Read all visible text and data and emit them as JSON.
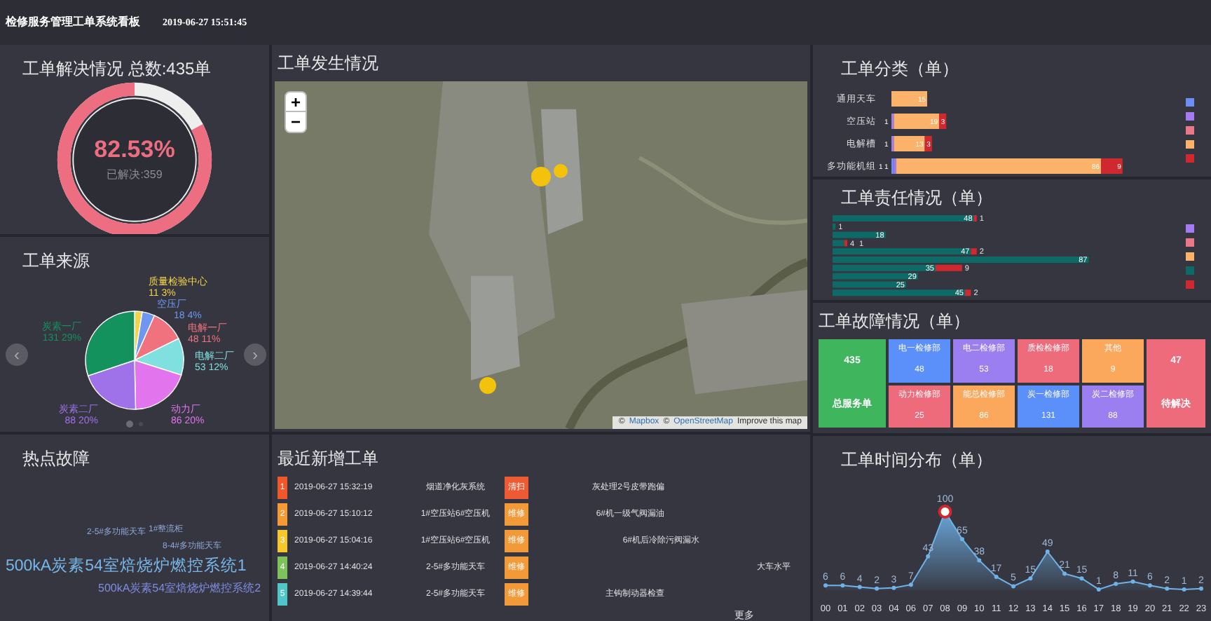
{
  "header": {
    "title": "检修服务管理工单系统看板",
    "datetime": "2019-06-27 15:51:45"
  },
  "resolution": {
    "title": "工单解决情况 总数:435单",
    "percent": "82.53%",
    "caption": "已解决:359",
    "level": 0.8253
  },
  "source": {
    "title": "工单来源",
    "prev": "‹",
    "next": "›",
    "dots": [
      {
        "selected": true
      },
      {
        "selected": false
      }
    ],
    "chart_data": {
      "type": "pie",
      "categories": [
        "质量检验中心",
        "空压厂",
        "电解一厂",
        "电解二厂",
        "动力厂",
        "炭素二厂",
        "炭素一厂"
      ],
      "values": [
        11,
        18,
        48,
        53,
        86,
        88,
        131
      ],
      "colors": [
        "#f2d34a",
        "#6f97f2",
        "#f0727e",
        "#7fe0df",
        "#e274ee",
        "#9f72ea",
        "#14925e"
      ],
      "value_labels": [
        "11  3%",
        "18  4%",
        "48  11%",
        "53  12%",
        "86  20%",
        "88  20%",
        "131  29%"
      ]
    }
  },
  "hot": {
    "title": "热点故障",
    "words": [
      {
        "text": "2-5#多功能天车"
      },
      {
        "text": "1#整流柜"
      },
      {
        "text": "8-4#多功能天车"
      },
      {
        "text": "500kA炭素54室焙烧炉燃控系统1"
      },
      {
        "text": "500kA炭素54室焙烧炉燃控系统2"
      }
    ]
  },
  "map": {
    "title": "工单发生情况",
    "zoom_in": "+",
    "zoom_out": "−",
    "attribution": [
      {
        "text": "©",
        "link": false
      },
      {
        "text": "Mapbox",
        "link": true
      },
      {
        "text": "©",
        "link": false
      },
      {
        "text": "OpenStreetMap",
        "link": true
      },
      {
        "text": "Improve this map",
        "link": false
      }
    ]
  },
  "orders": {
    "title": "最近新增工单",
    "more": "更多",
    "rows": [
      {
        "index": "1",
        "color": "#f0582c",
        "time": "2019-06-27 15:32:19",
        "device": "烟道净化灰系统",
        "badge": "清扫",
        "kind": "clean",
        "desc": "灰处理2号皮带跑偏"
      },
      {
        "index": "2",
        "color": "#f59a34",
        "time": "2019-06-27 15:10:12",
        "device": "1#空压站6#空压机",
        "badge": "维修",
        "kind": "repair",
        "desc": "6#机一级气阀漏油"
      },
      {
        "index": "3",
        "color": "#f6c82e",
        "time": "2019-06-27 15:04:16",
        "device": "1#空压站6#空压机",
        "badge": "维修",
        "kind": "repair",
        "desc": "6#机后冷除污阀漏水"
      },
      {
        "index": "4",
        "color": "#7dc25b",
        "time": "2019-06-27 14:40:24",
        "device": "2-5#多功能天车",
        "badge": "维修",
        "kind": "repair",
        "desc": "大车水平"
      },
      {
        "index": "5",
        "color": "#4fc6c9",
        "time": "2019-06-27 14:39:44",
        "device": "2-5#多功能天车",
        "badge": "维修",
        "kind": "repair",
        "desc": "主钩制动器检查"
      }
    ]
  },
  "category": {
    "title": "工单分类（单）",
    "chart_data": {
      "type": "bar",
      "orientation": "horizontal",
      "stacked": true,
      "data_labels": true,
      "categories": [
        "通用天车",
        "空压站",
        "电解槽",
        "多功能机组"
      ],
      "series": [
        {
          "color": "#6e8ef5",
          "values": [
            null,
            null,
            null,
            1
          ]
        },
        {
          "color": "#a47cf0",
          "values": [
            null,
            1,
            1,
            1
          ]
        },
        {
          "color": "#fbb36b",
          "values": [
            15,
            19,
            13,
            86
          ]
        },
        {
          "color": "#d0282f",
          "values": [
            null,
            3,
            3,
            9
          ]
        }
      ]
    },
    "legend": [
      {
        "color": "#6e8ef5"
      },
      {
        "color": "#a47cf0"
      },
      {
        "color": "#e8798a"
      },
      {
        "color": "#fbb36b"
      },
      {
        "color": "#d0282f"
      }
    ]
  },
  "duty": {
    "title": "工单责任情况（单）",
    "chart_data": {
      "type": "bar",
      "orientation": "horizontal",
      "stacked": true,
      "data_labels": true,
      "series": [
        {
          "color": "#0e6a66",
          "values": [
            48,
            1,
            18,
            4,
            47,
            87,
            35,
            29,
            25,
            45
          ]
        },
        {
          "color": "#d0282f",
          "values": [
            1,
            null,
            null,
            1,
            2,
            null,
            9,
            null,
            null,
            2
          ]
        }
      ]
    },
    "legend": [
      {
        "color": "#a47cf0"
      },
      {
        "color": "#e8798a"
      },
      {
        "color": "#fbb36b"
      },
      {
        "color": "#0e6a66"
      },
      {
        "color": "#d0282f"
      }
    ]
  },
  "faults": {
    "title": "工单故障情况（单）",
    "total": {
      "value": "435",
      "label": "总服务单",
      "color": "#3fb65e"
    },
    "pending": {
      "value": "47",
      "label": "待解决",
      "color": "#ee6b7c"
    },
    "groups": [
      [
        {
          "name": "电一检修部",
          "value": "48",
          "color": "#5b8ff9"
        },
        {
          "name": "电二检修部",
          "value": "53",
          "color": "#9b7ef0"
        },
        {
          "name": "动力检修部",
          "value": "25",
          "color": "#ee6b7c"
        },
        {
          "name": "能总检修部",
          "value": "86",
          "color": "#fba85d"
        }
      ],
      [
        {
          "name": "质检检修部",
          "value": "18",
          "color": "#ee6b7c"
        },
        {
          "name": "其他",
          "value": "9",
          "color": "#fba85d"
        },
        {
          "name": "炭一检修部",
          "value": "131",
          "color": "#5b8ff9"
        },
        {
          "name": "炭二检修部",
          "value": "88",
          "color": "#9b7ef0"
        }
      ]
    ]
  },
  "timeline": {
    "title": "工单时间分布（单）",
    "chart_data": {
      "type": "area",
      "data_labels": true,
      "x": [
        "00",
        "01",
        "02",
        "03",
        "04",
        "06",
        "07",
        "08",
        "09",
        "10",
        "11",
        "12",
        "13",
        "14",
        "15",
        "16",
        "17",
        "18",
        "19",
        "20",
        "21",
        "22",
        "23"
      ],
      "series": [
        {
          "color": "#6fb2e8",
          "values": [
            6,
            6,
            4,
            2,
            3,
            7,
            43,
            100,
            65,
            38,
            17,
            5,
            15,
            49,
            21,
            15,
            1,
            8,
            11,
            6,
            2,
            1,
            2
          ]
        }
      ]
    }
  }
}
